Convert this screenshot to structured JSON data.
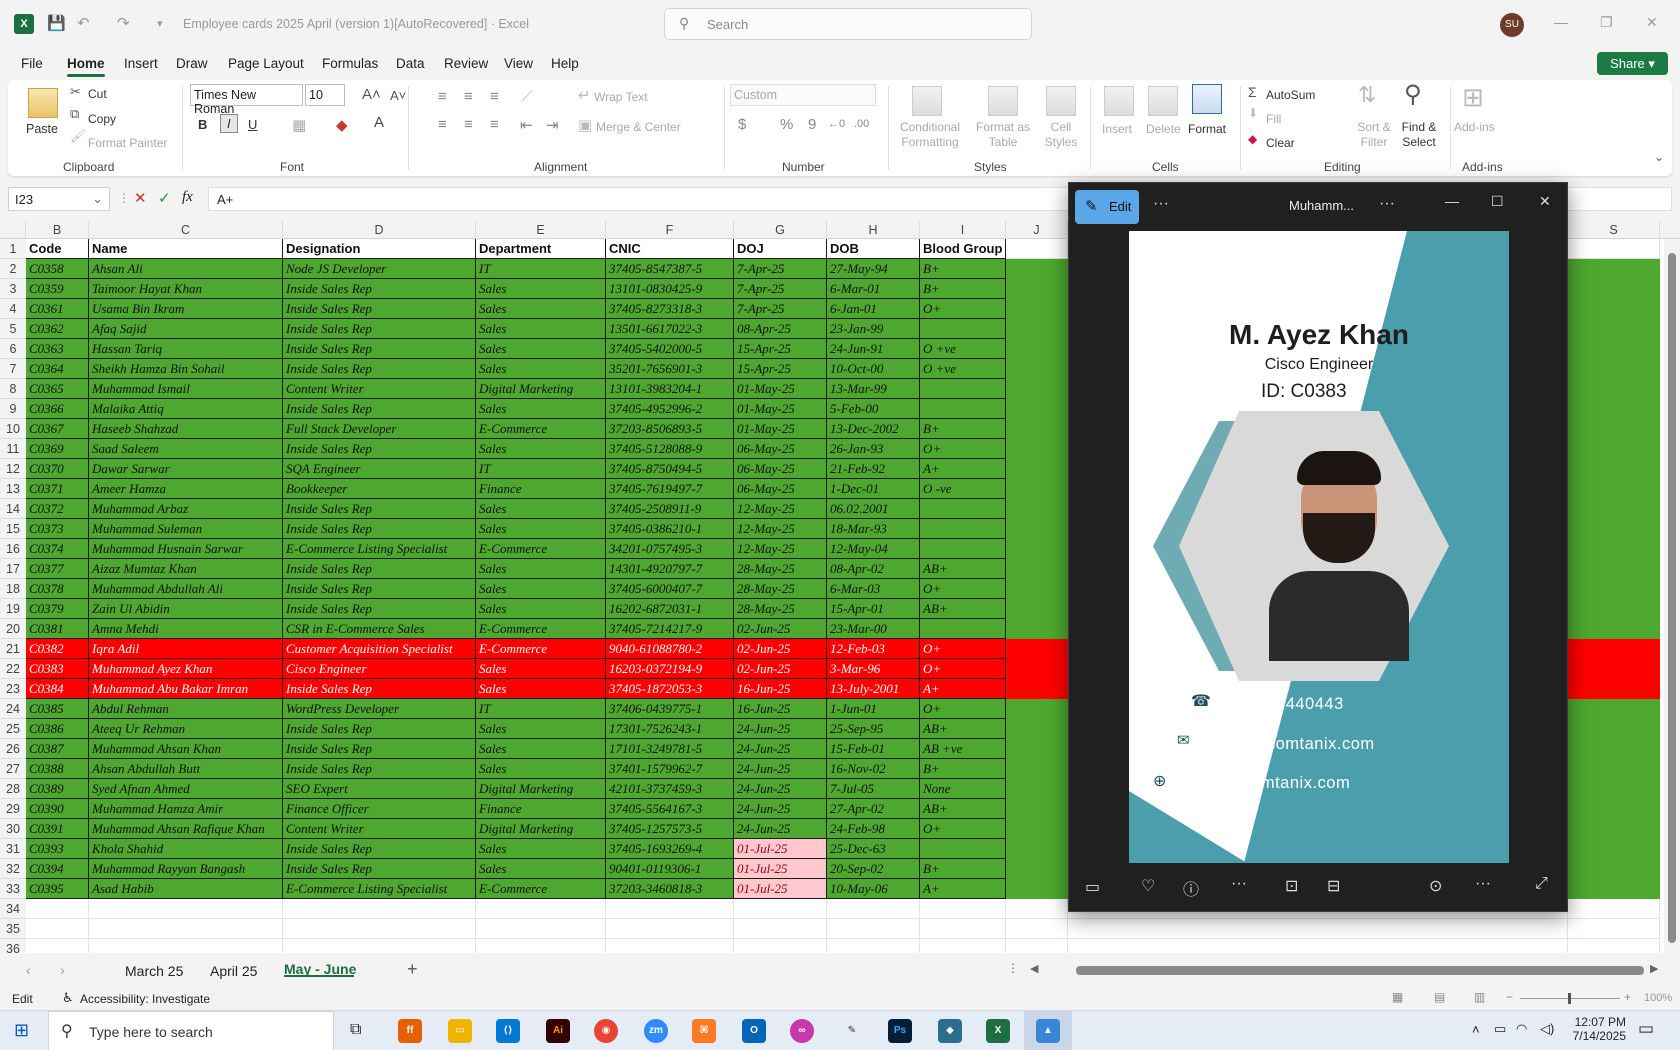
{
  "app": {
    "doc_title": "Employee cards 2025 April (version 1)[AutoRecovered]  ·  Excel",
    "search_placeholder": "Search",
    "user_initials": "SU"
  },
  "menu": [
    "File",
    "Home",
    "Insert",
    "Draw",
    "Page Layout",
    "Formulas",
    "Data",
    "Review",
    "View",
    "Help"
  ],
  "share_label": "Share",
  "ribbon": {
    "clipboard": {
      "paste": "Paste",
      "cut": "Cut",
      "copy": "Copy",
      "format_painter": "Format Painter",
      "label": "Clipboard"
    },
    "font": {
      "family": "Times New Roman",
      "size": "10",
      "label": "Font",
      "bold": "B",
      "italic": "I",
      "underline": "U"
    },
    "alignment": {
      "wrap": "Wrap Text",
      "merge": "Merge & Center",
      "label": "Alignment"
    },
    "number": {
      "format": "Custom",
      "label": "Number"
    },
    "styles": {
      "conditional": "Conditional Formatting",
      "table": "Format as Table",
      "cell": "Cell Styles",
      "label": "Styles"
    },
    "cells": {
      "insert": "Insert",
      "delete": "Delete",
      "format": "Format",
      "label": "Cells"
    },
    "editing": {
      "autosum": "AutoSum",
      "fill": "Fill",
      "clear": "Clear",
      "sort": "Sort & Filter",
      "find": "Find & Select",
      "label": "Editing"
    },
    "addins": {
      "addins": "Add-ins",
      "label": "Add-ins"
    }
  },
  "formula": {
    "cell_ref": "I23",
    "value": "A+"
  },
  "columns": [
    "B",
    "C",
    "D",
    "E",
    "F",
    "G",
    "H",
    "I",
    "J",
    "S"
  ],
  "headers": [
    "Code",
    "Name",
    "Designation",
    "Department",
    "CNIC",
    "DOJ",
    "DOB",
    "Blood Group"
  ],
  "rows": [
    [
      "C0358",
      "Ahsan Ali",
      "Node JS Developer",
      "IT",
      "37405-8547387-5",
      "7-Apr-25",
      "27-May-94",
      "B+"
    ],
    [
      "C0359",
      "Taimoor Hayat Khan",
      "Inside Sales Rep",
      "Sales",
      "13101-0830425-9",
      "7-Apr-25",
      "6-Mar-01",
      "B+"
    ],
    [
      "C0361",
      "Usama Bin Ikram",
      "Inside Sales Rep",
      "Sales",
      "37405-8273318-3",
      "7-Apr-25",
      "6-Jan-01",
      "O+"
    ],
    [
      "C0362",
      "Afaq Sajid",
      "Inside Sales Rep",
      "Sales",
      "13501-6617022-3",
      "08-Apr-25",
      "23-Jan-99",
      ""
    ],
    [
      "C0363",
      "Hassan Tariq",
      "Inside Sales Rep",
      "Sales",
      "37405-5402000-5",
      "15-Apr-25",
      "24-Jun-91",
      "O +ve"
    ],
    [
      "C0364",
      "Sheikh Hamza Bin Sohail",
      "Inside Sales Rep",
      "Sales",
      "35201-7656901-3",
      "15-Apr-25",
      "10-Oct-00",
      "O +ve"
    ],
    [
      "C0365",
      "Muhammad Ismail",
      "Content Writer",
      "Digital Marketing",
      "13101-3983204-1",
      "01-May-25",
      "13-Mar-99",
      ""
    ],
    [
      "C0366",
      "Malaika Attiq",
      "Inside Sales Rep",
      "Sales",
      "37405-4952996-2",
      "01-May-25",
      "5-Feb-00",
      ""
    ],
    [
      "C0367",
      "Haseeb Shahzad",
      "Full Stack Developer",
      "E-Commerce",
      "37203-8506893-5",
      "01-May-25",
      "13-Dec-2002",
      "B+"
    ],
    [
      "C0369",
      "Saad Saleem",
      "Inside Sales Rep",
      "Sales",
      "37405-5128088-9",
      "06-May-25",
      "26-Jan-93",
      "O+"
    ],
    [
      "C0370",
      "Dawar Sarwar",
      "SQA Engineer",
      "IT",
      "37405-8750494-5",
      "06-May-25",
      "21-Feb-92",
      "A+"
    ],
    [
      "C0371",
      "Ameer Hamza",
      "Bookkeeper",
      "Finance",
      "37405-7619497-7",
      "06-May-25",
      "1-Dec-01",
      "O -ve"
    ],
    [
      "C0372",
      "Muhammad Arbaz",
      "Inside Sales Rep",
      "Sales",
      "37405-2508911-9",
      "12-May-25",
      "06.02.2001",
      ""
    ],
    [
      "C0373",
      "Muhammad Suleman",
      "Inside Sales Rep",
      "Sales",
      "37405-0386210-1",
      "12-May-25",
      "18-Mar-93",
      ""
    ],
    [
      "C0374",
      "Muhammad Husnain Sarwar",
      "E-Commerce Listing Specialist",
      "E-Commerce",
      "34201-0757495-3",
      "12-May-25",
      "12-May-04",
      ""
    ],
    [
      "C0377",
      "Aizaz Mumtaz Khan",
      "Inside Sales Rep",
      "Sales",
      "14301-4920797-7",
      "28-May-25",
      "08-Apr-02",
      "AB+"
    ],
    [
      "C0378",
      "Muhammad Abdullah Ali",
      "Inside Sales Rep",
      "Sales",
      "37405-6000407-7",
      "28-May-25",
      "6-Mar-03",
      "O+"
    ],
    [
      "C0379",
      "Zain Ul Abidin",
      "Inside Sales Rep",
      "Sales",
      "16202-6872031-1",
      "28-May-25",
      "15-Apr-01",
      "AB+"
    ],
    [
      "C0381",
      "Amna Mehdi",
      "CSR in E-Commerce Sales",
      "E-Commerce",
      "37405-7214217-9",
      "02-Jun-25",
      "23-Mar-00",
      ""
    ],
    [
      "C0382",
      "Iqra Adil",
      "Customer Acquisition Specialist",
      "E-Commerce",
      "9040-61088780-2",
      "02-Jun-25",
      "12-Feb-03",
      "O+"
    ],
    [
      "C0383",
      "Muhammad Ayez Khan",
      "Cisco Engineer",
      "Sales",
      "16203-0372194-9",
      "02-Jun-25",
      "3-Mar-96",
      "O+"
    ],
    [
      "C0384",
      "Muhammad Abu Bakar Imran",
      "Inside Sales Rep",
      "Sales",
      "37405-1872053-3",
      "16-Jun-25",
      "13-July-2001",
      "A+"
    ],
    [
      "C0385",
      "Abdul Rehman",
      "WordPress Developer",
      "IT",
      "37406-0439775-1",
      "16-Jun-25",
      "1-Jun-01",
      "O+"
    ],
    [
      "C0386",
      "Ateeq Ur Rehman",
      "Inside Sales Rep",
      "Sales",
      "17301-7526243-1",
      "24-Jun-25",
      "25-Sep-95",
      "AB+"
    ],
    [
      "C0387",
      "Muhammad Ahsan Khan",
      "Inside Sales Rep",
      "Sales",
      "17101-3249781-5",
      "24-Jun-25",
      "15-Feb-01",
      "AB +ve"
    ],
    [
      "C0388",
      "Ahsan Abdullah Butt",
      "Inside Sales Rep",
      "Sales",
      "37401-1579962-7",
      "24-Jun-25",
      "16-Nov-02",
      "B+"
    ],
    [
      "C0389",
      "Syed Afnan Ahmed",
      "SEO Expert",
      "Digital Marketing",
      "42101-3737459-3",
      "24-Jun-25",
      "7-Jul-05",
      "None"
    ],
    [
      "C0390",
      "Muhammad Hamza Amir",
      "Finance Officer",
      "Finance",
      "37405-5564167-3",
      "24-Jun-25",
      "27-Apr-02",
      "AB+"
    ],
    [
      "C0391",
      "Muhammad Ahsan Rafique Khan",
      "Content Writer",
      "Digital Marketing",
      "37405-1257573-5",
      "24-Jun-25",
      "24-Feb-98",
      "O+"
    ],
    [
      "C0393",
      "Khola Shahid",
      "Inside Sales Rep",
      "Sales",
      "37405-1693269-4",
      "01-Jul-25",
      "25-Dec-63",
      ""
    ],
    [
      "C0394",
      "Muhammad Rayyan Bangash",
      "Inside Sales Rep",
      "Sales",
      "90401-0119306-1",
      "01-Jul-25",
      "20-Sep-02",
      "B+"
    ],
    [
      "C0395",
      "Asad Habib",
      "E-Commerce Listing Specialist",
      "E-Commerce",
      "37203-3460818-3",
      "01-Jul-25",
      "10-May-06",
      "A+"
    ]
  ],
  "red_rows": [
    19,
    20,
    21
  ],
  "pink_doj_rows": [
    29,
    30,
    31
  ],
  "colors": {
    "green": "#4ea72e",
    "red": "#ff0000",
    "pink": "#ffc7ce",
    "pink_text": "#9c0006",
    "excel_green": "#1d6f42",
    "card_teal": "#4b9eab"
  },
  "sheets": [
    "March 25",
    "April 25",
    "May - June"
  ],
  "active_sheet": "May - June",
  "status": {
    "mode": "Edit",
    "accessibility": "Accessibility: Investigate",
    "zoom": "100%"
  },
  "taskbar": {
    "search_placeholder": "Type here to search",
    "time": "12:07 PM",
    "date": "7/14/2025"
  },
  "viewer": {
    "edit_label": "Edit",
    "title": "Muhamm...",
    "card": {
      "name": "M. Ayez Khan",
      "role": "Cisco Engineer",
      "id": "ID: C0383",
      "phone": "051-8440443",
      "email": "info@comtanix.com",
      "web": "www.comtanix.com"
    }
  }
}
